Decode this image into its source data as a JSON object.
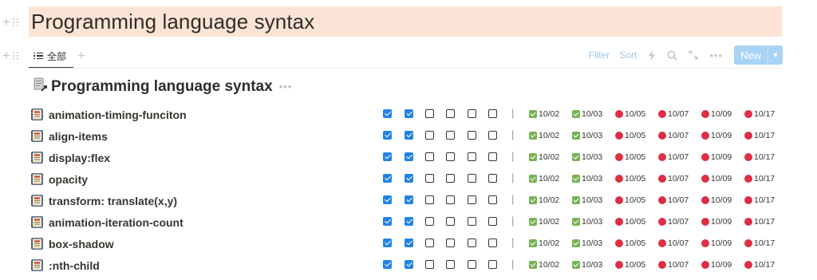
{
  "page": {
    "title": "Programming language syntax",
    "title_bg": "#fbe4d5"
  },
  "views": {
    "active_tab_label": "全部",
    "active_tab_icon": "list-icon",
    "add_view_icon": "plus-icon"
  },
  "toolbar": {
    "filter_label": "Filter",
    "sort_label": "Sort",
    "automation_icon": "lightning-icon",
    "search_icon": "search-icon",
    "expand_icon": "expand-icon",
    "more_icon": "ellipsis-icon",
    "new_label": "New",
    "new_arrow_icon": "chevron-down-icon",
    "accent": "#a9d3f5"
  },
  "list": {
    "title": "Programming language syntax",
    "title_icon": "document-link-icon",
    "more_icon": "ellipsis-icon",
    "separator": "|",
    "row_icon": "notebook-icon",
    "checkbox_accent": "#2383e2",
    "done_tag_icon": "green-check-icon",
    "todo_tag_icon": "red-circle-icon",
    "rows": [
      {
        "name": "animation-timing-funciton",
        "checks": [
          true,
          true,
          false,
          false,
          false,
          false
        ],
        "tags": [
          {
            "label": "10/02",
            "done": true
          },
          {
            "label": "10/03",
            "done": true
          },
          {
            "label": "10/05",
            "done": false
          },
          {
            "label": "10/07",
            "done": false
          },
          {
            "label": "10/09",
            "done": false
          },
          {
            "label": "10/17",
            "done": false
          }
        ]
      },
      {
        "name": "align-items",
        "checks": [
          true,
          true,
          false,
          false,
          false,
          false
        ],
        "tags": [
          {
            "label": "10/02",
            "done": true
          },
          {
            "label": "10/03",
            "done": true
          },
          {
            "label": "10/05",
            "done": false
          },
          {
            "label": "10/07",
            "done": false
          },
          {
            "label": "10/09",
            "done": false
          },
          {
            "label": "10/17",
            "done": false
          }
        ]
      },
      {
        "name": "display:flex",
        "checks": [
          true,
          true,
          false,
          false,
          false,
          false
        ],
        "tags": [
          {
            "label": "10/02",
            "done": true
          },
          {
            "label": "10/03",
            "done": true
          },
          {
            "label": "10/05",
            "done": false
          },
          {
            "label": "10/07",
            "done": false
          },
          {
            "label": "10/09",
            "done": false
          },
          {
            "label": "10/17",
            "done": false
          }
        ]
      },
      {
        "name": "opacity",
        "checks": [
          true,
          true,
          false,
          false,
          false,
          false
        ],
        "tags": [
          {
            "label": "10/02",
            "done": true
          },
          {
            "label": "10/03",
            "done": true
          },
          {
            "label": "10/05",
            "done": false
          },
          {
            "label": "10/07",
            "done": false
          },
          {
            "label": "10/09",
            "done": false
          },
          {
            "label": "10/17",
            "done": false
          }
        ]
      },
      {
        "name": "transform: translate(x,y)",
        "checks": [
          true,
          true,
          false,
          false,
          false,
          false
        ],
        "tags": [
          {
            "label": "10/02",
            "done": true
          },
          {
            "label": "10/03",
            "done": true
          },
          {
            "label": "10/05",
            "done": false
          },
          {
            "label": "10/07",
            "done": false
          },
          {
            "label": "10/09",
            "done": false
          },
          {
            "label": "10/17",
            "done": false
          }
        ]
      },
      {
        "name": "animation-iteration-count",
        "checks": [
          true,
          true,
          false,
          false,
          false,
          false
        ],
        "tags": [
          {
            "label": "10/02",
            "done": true
          },
          {
            "label": "10/03",
            "done": true
          },
          {
            "label": "10/05",
            "done": false
          },
          {
            "label": "10/07",
            "done": false
          },
          {
            "label": "10/09",
            "done": false
          },
          {
            "label": "10/17",
            "done": false
          }
        ]
      },
      {
        "name": "box-shadow",
        "checks": [
          true,
          true,
          false,
          false,
          false,
          false
        ],
        "tags": [
          {
            "label": "10/02",
            "done": true
          },
          {
            "label": "10/03",
            "done": true
          },
          {
            "label": "10/05",
            "done": false
          },
          {
            "label": "10/07",
            "done": false
          },
          {
            "label": "10/09",
            "done": false
          },
          {
            "label": "10/17",
            "done": false
          }
        ]
      },
      {
        "name": ":nth-child",
        "checks": [
          true,
          true,
          false,
          false,
          false,
          false
        ],
        "tags": [
          {
            "label": "10/02",
            "done": true
          },
          {
            "label": "10/03",
            "done": true
          },
          {
            "label": "10/05",
            "done": false
          },
          {
            "label": "10/07",
            "done": false
          },
          {
            "label": "10/09",
            "done": false
          },
          {
            "label": "10/17",
            "done": false
          }
        ]
      }
    ]
  }
}
